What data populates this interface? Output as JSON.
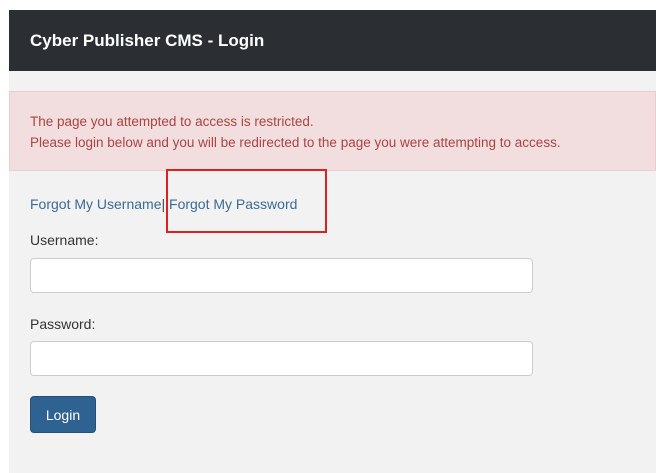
{
  "header": {
    "title": "Cyber Publisher CMS - Login"
  },
  "alert": {
    "line1": "The page you attempted to access is restricted.",
    "line2": "Please login below and you will be redirected to the page you were attempting to access."
  },
  "links": {
    "forgot_username": "Forgot My Username",
    "separator": "|",
    "forgot_password": "Forgot My Password"
  },
  "form": {
    "username_label": "Username:",
    "username_value": "",
    "password_label": "Password:",
    "password_value": "",
    "login_label": "Login"
  },
  "colors": {
    "header_bg": "#2b2f33",
    "alert_bg": "#f2dede",
    "alert_text": "#a94442",
    "link": "#3b6a95",
    "button_bg": "#2d6291",
    "highlight_border": "#e02020"
  }
}
